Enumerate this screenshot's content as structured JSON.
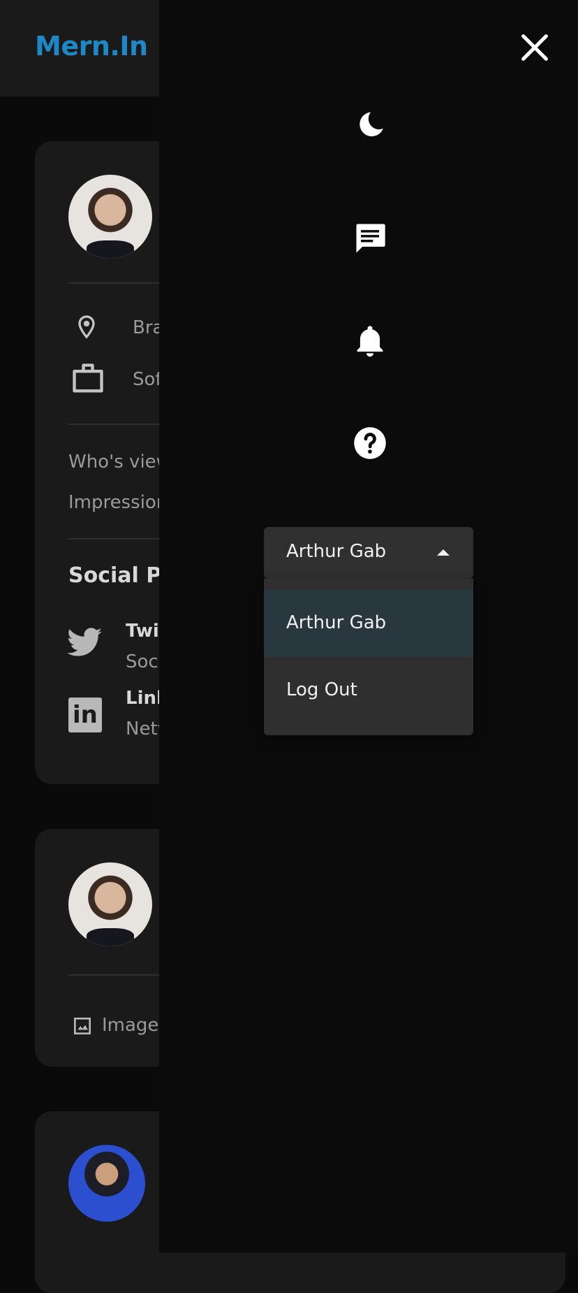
{
  "header": {
    "logo": "Mern.In"
  },
  "profile_card": {
    "location": "Bra",
    "occupation": "Sof",
    "stats": [
      {
        "label": "Who's view"
      },
      {
        "label": "Impressior"
      }
    ],
    "social_title": "Social Pr",
    "socials": [
      {
        "name": "Twit",
        "sub": "Soc",
        "icon": "twitter-icon"
      },
      {
        "name": "Link",
        "sub": "Netv",
        "icon": "linkedin-icon"
      }
    ]
  },
  "post_card": {
    "image_label": "Image"
  },
  "drawer": {
    "icons": [
      "moon-icon",
      "message-icon",
      "bell-icon",
      "help-icon"
    ],
    "user_select": {
      "value": "Arthur Gab",
      "options": [
        "Arthur Gab",
        "Log Out"
      ]
    }
  },
  "colors": {
    "brand": "#1e88c6",
    "drawer_bg": "#0b0b0b",
    "selected_option_bg": "#29373f"
  }
}
